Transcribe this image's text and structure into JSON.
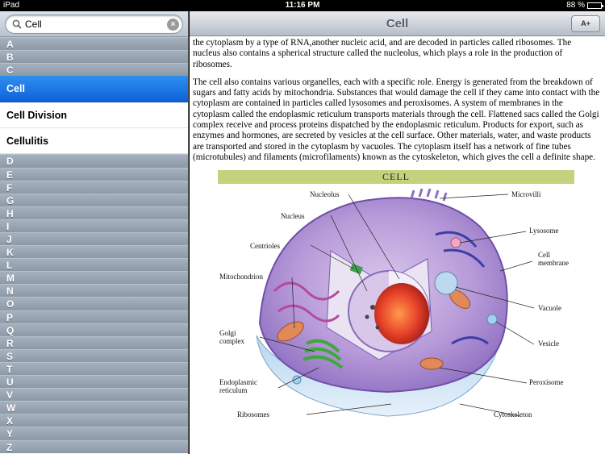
{
  "status": {
    "device": "iPad",
    "time": "11:16 PM",
    "battery": "88 %"
  },
  "sidebar": {
    "search": {
      "value": "Cell"
    },
    "letters_top": [
      "A",
      "B",
      "C"
    ],
    "entries": [
      {
        "label": "Cell",
        "selected": true
      },
      {
        "label": "Cell Division",
        "selected": false
      },
      {
        "label": "Cellulitis",
        "selected": false
      }
    ],
    "letters_bottom": [
      "D",
      "E",
      "F",
      "G",
      "H",
      "I",
      "J",
      "K",
      "L",
      "M",
      "N",
      "O",
      "P",
      "Q",
      "R",
      "S",
      "T",
      "U",
      "V",
      "W",
      "X",
      "Y",
      "Z"
    ]
  },
  "header": {
    "title": "Cell",
    "font_button": "A+"
  },
  "article": {
    "paragraphs": [
      "the cytoplasm by a type of RNA,another nucleic acid, and are decoded in particles called ribosomes. The nucleus also contains a spherical structure called the nucleolus, which plays a role in the production of ribosomes.",
      "The cell also contains various organelles, each with a specific role. Energy is generated from the breakdown of sugars and fatty acids by mitochondria. Substances that would damage the cell if they came into contact with the cytoplasm are contained in particles called lysosomes and peroxisomes. A system of membranes in the cytoplasm called the endoplasmic reticulum transports materials through the cell. Flattened sacs called the Golgi complex receive and process proteins dispatched by the endoplasmic reticulum. Products for export, such as enzymes and hormones, are secreted by vesicles at the cell surface. Other materials, water, and waste products are transported and stored in the cytoplasm by vacuoles. The cytoplasm itself has a network of fine tubes (microtubules) and filaments (microfilaments) known as the cytoskeleton, which gives the cell a definite shape."
    ]
  },
  "figure": {
    "title": "CELL",
    "labels": {
      "nucleolus": "Nucleolus",
      "nucleus": "Nucleus",
      "centrioles": "Centrioles",
      "mitochondrion": "Mitochondrion",
      "golgi_1": "Golgi",
      "golgi_2": "complex",
      "er_1": "Endoplasmic",
      "er_2": "reticulum",
      "ribosomes": "Ribosomes",
      "microvilli": "Microvilli",
      "lysosome": "Lysosome",
      "membrane_1": "Cell",
      "membrane_2": "membrane",
      "vacuole": "Vacuole",
      "vesicle": "Vesicle",
      "peroxisome": "Peroxisome",
      "cytoskeleton": "Cytoskeleton"
    }
  },
  "colors": {
    "selected_row": "#1a6fe0",
    "figure_banner": "#c5d27c"
  }
}
